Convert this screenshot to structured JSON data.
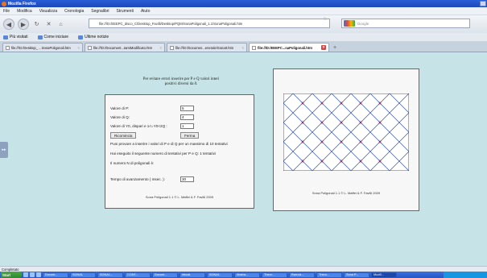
{
  "window": {
    "title": "Mozilla Firefox"
  },
  "menu": [
    "File",
    "Modifica",
    "Visualizza",
    "Cronologia",
    "Segnalibri",
    "Strumenti",
    "Aiuto"
  ],
  "nav": {
    "url": "file:///D:/EEEPC_disco_C/Desktop_Favilli/Desktop/PQM/SonaPoligonali_1.1/SonaPoligonali.htm",
    "search_placeholder": "Google"
  },
  "bookmarks": [
    "Più visitati",
    "Come iniziare",
    "Ultime notizie"
  ],
  "tabs": [
    {
      "label": "file:///D:/Desktop_ ...SonaPoligonali.htm",
      "active": false
    },
    {
      "label": "file:///D:/Document...tamiModificato.htm",
      "active": false
    },
    {
      "label": "file:///D:/Documen...enerale/SonaIt.htm",
      "active": false
    },
    {
      "label": "file:///D:/EEEPC...naPoligonali.htm",
      "active": true
    }
  ],
  "page": {
    "intro": "Per evitare errori inserire per P e Q valori interi positivi diversi da 0.",
    "fields": [
      {
        "label": "Valore di P:",
        "value": "5"
      },
      {
        "label": "Valore di Q:",
        "value": "4"
      },
      {
        "label": "Valore di Y0, dispari e 1<=Y0<2Q :",
        "value": "1"
      }
    ],
    "buttons": {
      "restart": "Ricomincia",
      "stop": "Ferma"
    },
    "info1": "Puoi provare a inserire i valori di P e di Q per un massimo di 10 tentativi",
    "info2": "Hai eseguito il seguente numero di tentativi per P e Q: 1 tentativi",
    "info3": "Il numero N di poligonali è:",
    "speed_label": "Tempo di avanzamento ( msec. ):",
    "speed_value": "30",
    "credit_left": "Sona Poligonali 1.1 © L. Maffei & F. Favilli 2009",
    "credit_right": "Sona Poligonali 1.1 © L. Maffei & F. Favilli 2009"
  },
  "status": "Completato",
  "taskbar": {
    "start": "Start",
    "items": [
      "Docum...",
      "SONA1",
      "SONA1...",
      "CONT...",
      "Docum...",
      "ebook",
      "SONA1",
      "Abstra...",
      "Theor...",
      "Eserciz...",
      "Theor...",
      "Sona P...",
      "Mozill..."
    ]
  }
}
